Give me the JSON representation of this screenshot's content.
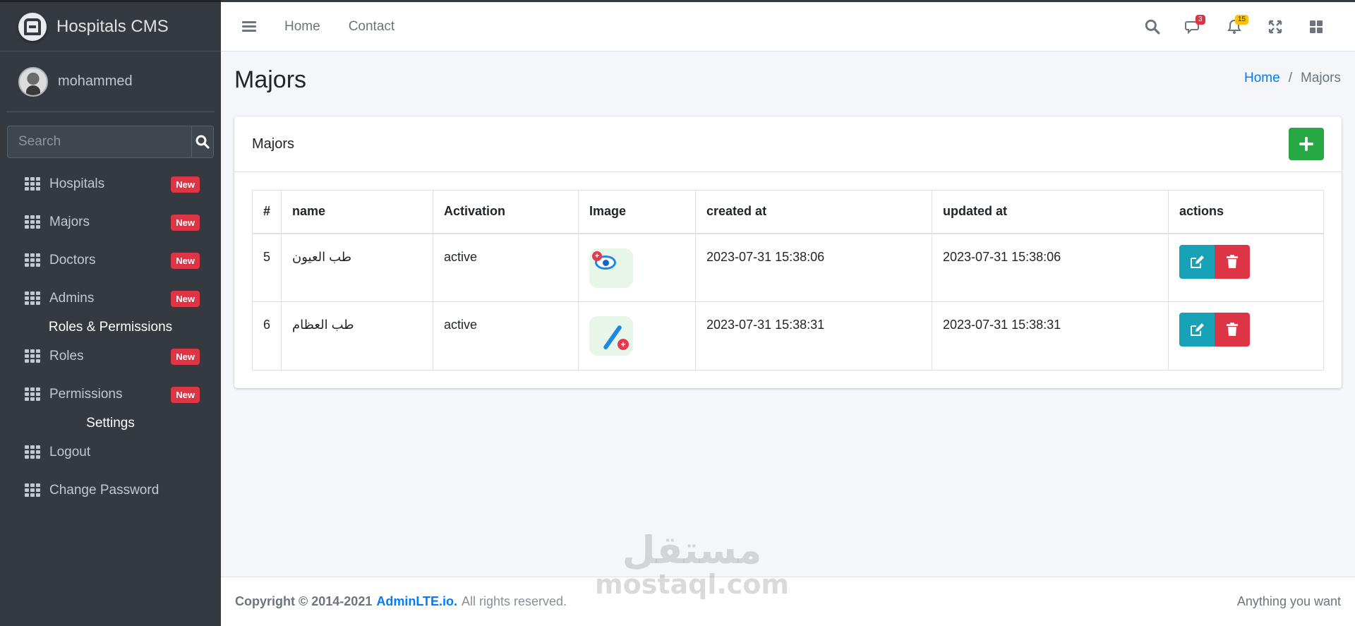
{
  "brand": {
    "title": "Hospitals CMS"
  },
  "user": {
    "name": "mohammed"
  },
  "search": {
    "placeholder": "Search"
  },
  "sidebar": {
    "items": [
      {
        "label": "Hospitals",
        "badge": "New"
      },
      {
        "label": "Majors",
        "badge": "New"
      },
      {
        "label": "Doctors",
        "badge": "New"
      },
      {
        "label": "Admins",
        "badge": "New"
      },
      {
        "label": "Roles",
        "badge": "New"
      },
      {
        "label": "Permissions",
        "badge": "New"
      },
      {
        "label": "Logout"
      },
      {
        "label": "Change Password"
      }
    ],
    "headers": [
      "Roles & Permissions",
      "Settings"
    ]
  },
  "topbar": {
    "links": [
      "Home",
      "Contact"
    ],
    "messages_count": "3",
    "notifications_count": "15"
  },
  "page": {
    "title": "Majors",
    "breadcrumb": {
      "home": "Home",
      "separator": "/",
      "current": "Majors"
    }
  },
  "card": {
    "title": "Majors",
    "columns": [
      "#",
      "name",
      "Activation",
      "Image",
      "created at",
      "updated at",
      "actions"
    ],
    "rows": [
      {
        "id": "5",
        "name": "طب العيون",
        "activation": "active",
        "image": "eye-medical-icon",
        "created_at": "2023-07-31 15:38:06",
        "updated_at": "2023-07-31 15:38:06"
      },
      {
        "id": "6",
        "name": "طب العظام",
        "activation": "active",
        "image": "crutch-medical-icon",
        "created_at": "2023-07-31 15:38:31",
        "updated_at": "2023-07-31 15:38:31"
      }
    ]
  },
  "footer": {
    "copyright": "Copyright © 2014-2021",
    "link": "AdminLTE.io.",
    "rights": "All rights reserved.",
    "right_text": "Anything you want"
  },
  "watermark": {
    "arabic": "مستقل",
    "latin": "mostaql.com"
  },
  "colors": {
    "sidebar_bg": "#343a40",
    "primary": "#007bff",
    "success": "#28a745",
    "danger": "#dc3545",
    "info": "#17a2b8",
    "warning": "#ffc107"
  }
}
